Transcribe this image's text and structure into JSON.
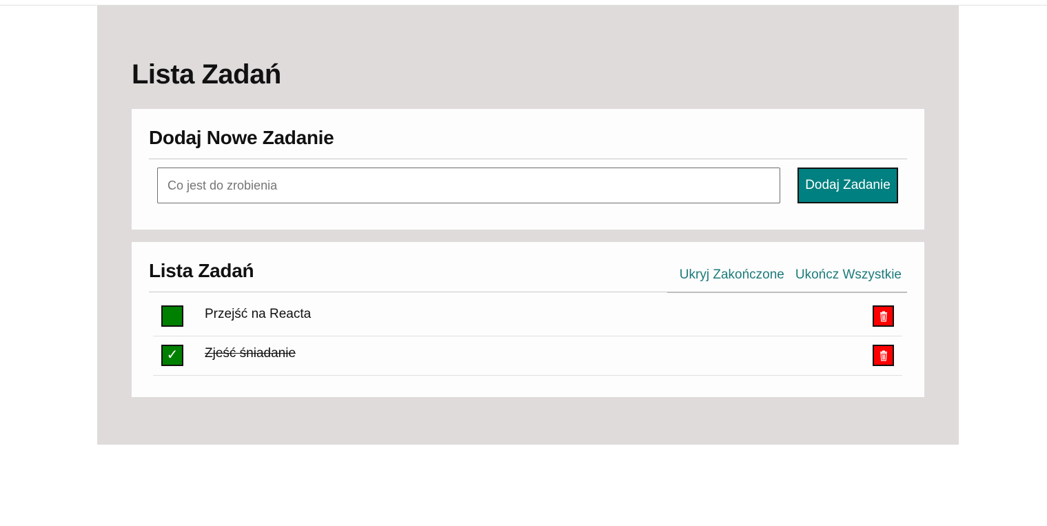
{
  "page": {
    "title": "Lista Zadań"
  },
  "add_section": {
    "title": "Dodaj Nowe Zadanie",
    "input_placeholder": "Co jest do zrobienia",
    "input_value": "",
    "button_label": "Dodaj Zadanie"
  },
  "list_section": {
    "title": "Lista Zadań",
    "hide_done_label": "Ukryj Zakończone",
    "complete_all_label": "Ukończ Wszystkie",
    "tasks": [
      {
        "name": "Przejść na Reacta",
        "done": false
      },
      {
        "name": "Zjeść śniadanie",
        "done": true
      }
    ]
  },
  "colors": {
    "accent": "#008080",
    "checkbox": "#008000",
    "delete": "#ff0000",
    "panel_bg": "#dfdbdb",
    "link": "#1d7a7a"
  },
  "icons": {
    "check": "check-icon",
    "delete": "trash-icon"
  }
}
